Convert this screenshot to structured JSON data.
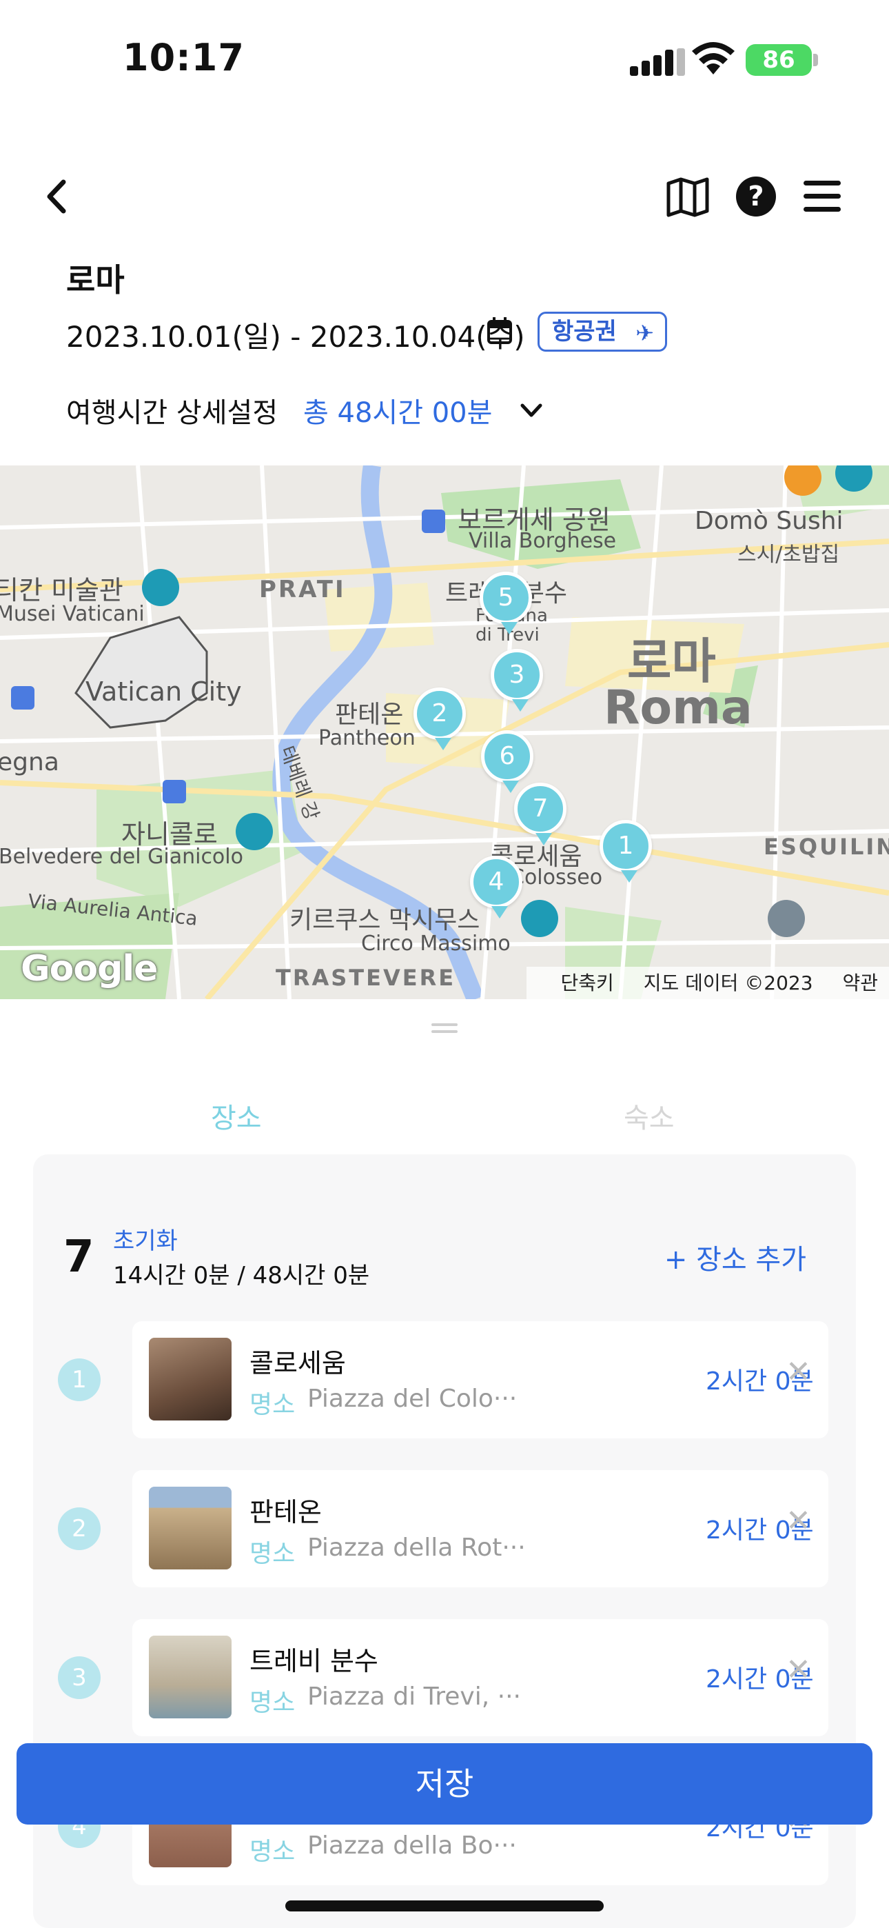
{
  "status_bar": {
    "time": "10:17",
    "battery": "86"
  },
  "nav": {
    "help_label": "?"
  },
  "trip": {
    "city": "로마",
    "date_range": "2023.10.01(일) - 2023.10.04(수)",
    "flight_badge": "항공권",
    "time_setting_label": "여행시간 상세설정",
    "time_setting_value": "총 48시간 00분"
  },
  "map": {
    "labels": {
      "borghese_ko": "보르게세 공원",
      "borghese_en": "Villa Borghese",
      "domo": "Domò Sushi",
      "domo_sub": "스시/초밥집",
      "vatican_museum_ko": "티칸 미술관",
      "vatican_museum_en": "Musei Vaticani",
      "prati": "PRATI",
      "trevi_ko": "트레비 분수",
      "trevi_en": "Fontana di Trevi",
      "roma_ko": "로마",
      "roma_en": "Roma",
      "vatican_city": "Vatican City",
      "pantheon_ko": "판테온",
      "pantheon_en": "Pantheon",
      "tevere": "테베레 강",
      "egna": "egna",
      "janiculum_ko": "자니콜로",
      "janiculum_en": "Belvedere del Gianicolo",
      "colosseum_ko": "콜로세움",
      "colosseum_en": "Colosseo",
      "esquilino": "ESQUILIN",
      "aurelia": "Via Aurelia Antica",
      "circo_ko": "키르쿠스 막시무스",
      "circo_en": "Circo Massimo",
      "trastevere": "TRASTEVERE"
    },
    "pins": [
      "1",
      "2",
      "3",
      "4",
      "5",
      "6",
      "7"
    ],
    "google": "Google",
    "footer": {
      "shortcuts": "단축키",
      "data": "지도 데이터 ©2023",
      "terms": "약관"
    }
  },
  "tabs": {
    "places": "장소",
    "stay": "숙소"
  },
  "summary": {
    "count": "7",
    "reset": "초기화",
    "duration": "14시간 0분 / 48시간 0분",
    "add_place": "+ 장소 추가"
  },
  "places": [
    {
      "num": "1",
      "name": "콜로세움",
      "category": "명소",
      "address": "Piazza del Colo···",
      "duration": "2시간 0분",
      "thumb_color": "#8a6a55"
    },
    {
      "num": "2",
      "name": "판테온",
      "category": "명소",
      "address": "Piazza della Rot···",
      "duration": "2시간 0분",
      "thumb_color": "#b39a78"
    },
    {
      "num": "3",
      "name": "트레비 분수",
      "category": "명소",
      "address": "Piazza di Trevi, ···",
      "duration": "2시간 0분",
      "thumb_color": "#c7bfae"
    },
    {
      "num": "4",
      "name": "",
      "category": "명소",
      "address": "Piazza della Bo···",
      "duration": "2시간 0분",
      "thumb_color": "#9e7060"
    }
  ],
  "save_label": "저장",
  "colors": {
    "accent": "#2f6be0",
    "pin": "#6fcfe0",
    "category": "#88d4e2"
  }
}
